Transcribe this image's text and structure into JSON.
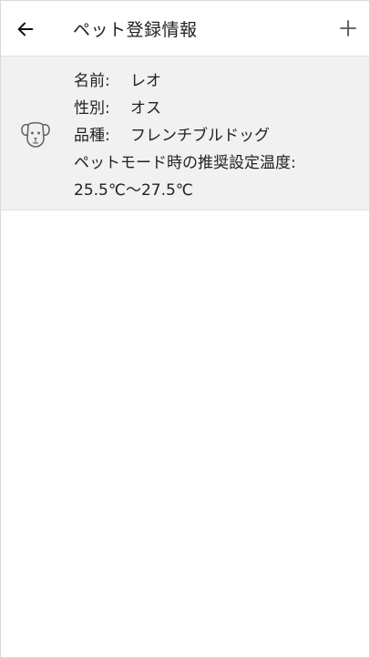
{
  "header": {
    "title": "ペット登録情報",
    "back_icon": "arrow-left-icon",
    "add_icon": "plus-icon"
  },
  "pet": {
    "icon": "dog-icon",
    "name_label": "名前:",
    "name_value": "レオ",
    "sex_label": "性別:",
    "sex_value": "オス",
    "breed_label": "品種:",
    "breed_value": "フレンチブルドッグ",
    "temp_label": "ペットモード時の推奨設定温度:",
    "temp_value": "25.5℃～27.5℃"
  },
  "colors": {
    "card_background": "#f1f1f1",
    "icon_color": "#666666",
    "text": "#222222"
  }
}
